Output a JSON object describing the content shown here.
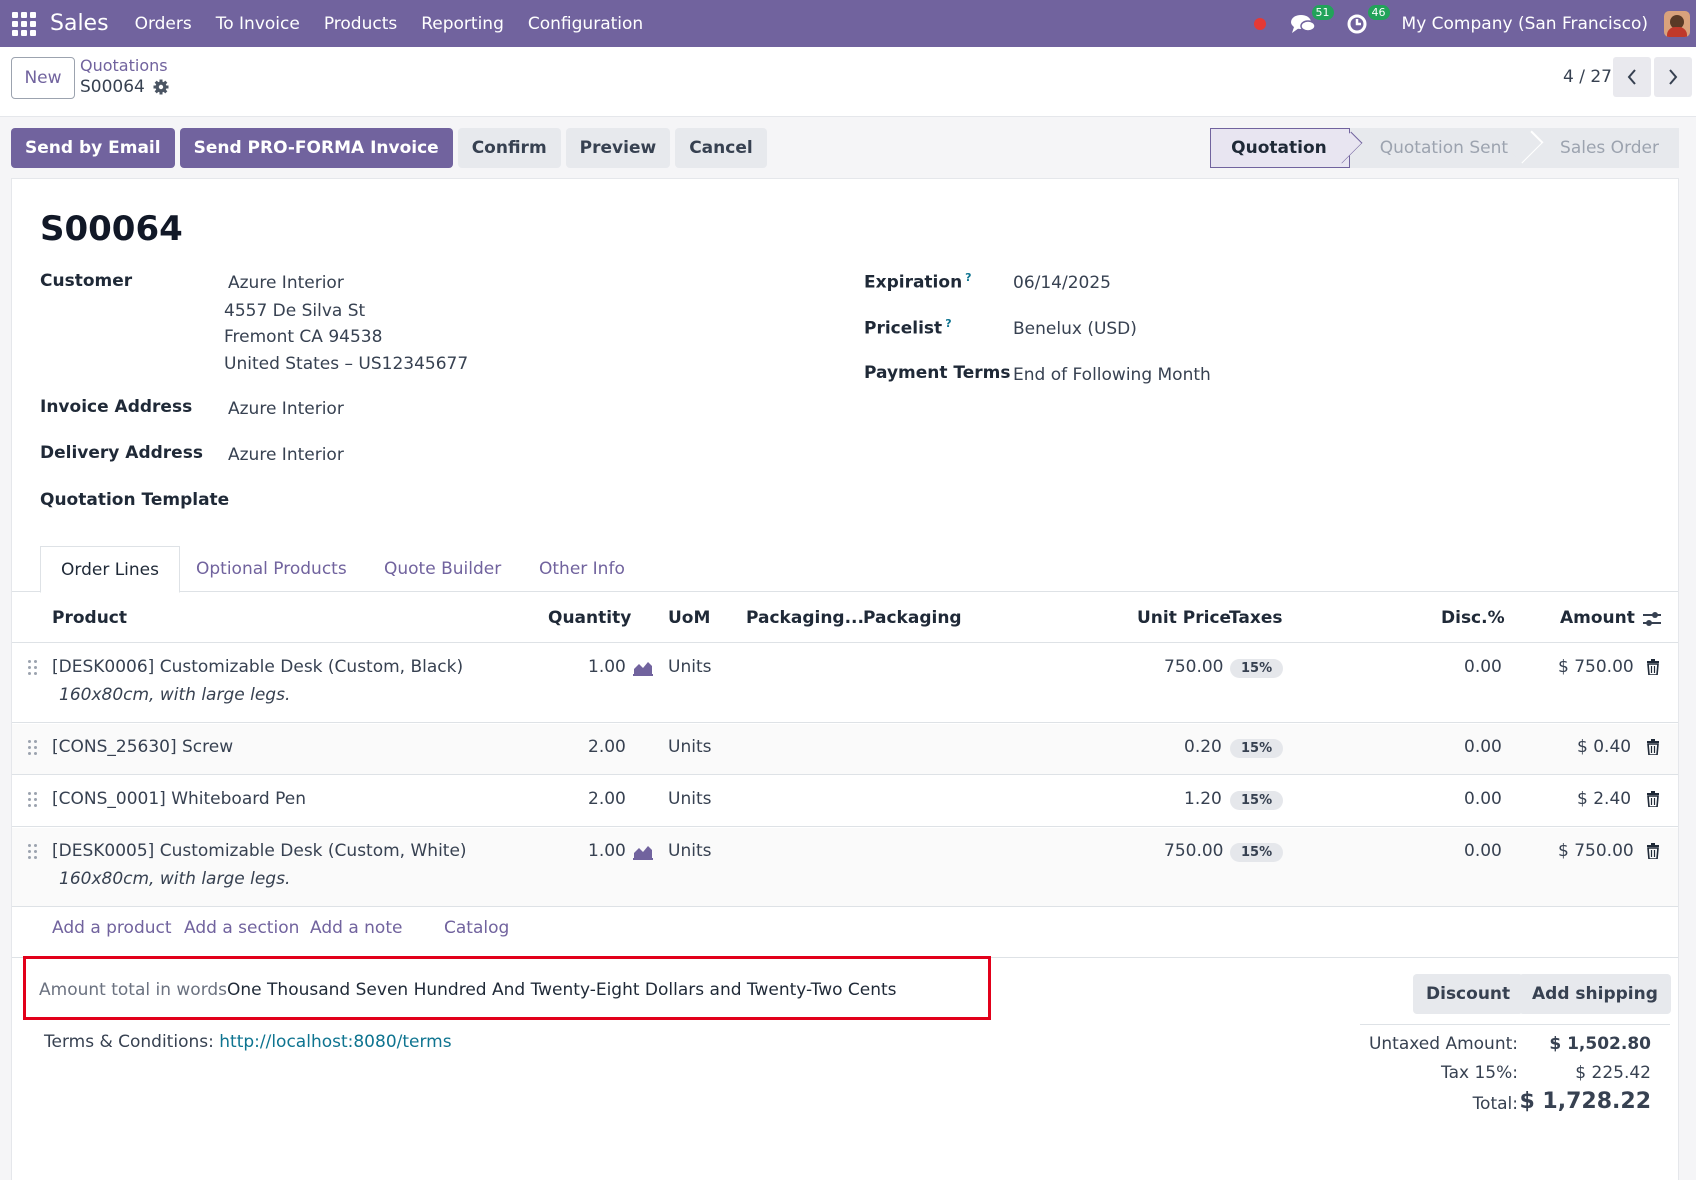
{
  "navbar": {
    "app_name": "Sales",
    "menu": [
      "Orders",
      "To Invoice",
      "Products",
      "Reporting",
      "Configuration"
    ],
    "messages_count": "51",
    "activities_count": "46",
    "company": "My Company (San Francisco)"
  },
  "control_panel": {
    "new_label": "New",
    "breadcrumb_parent": "Quotations",
    "breadcrumb_current": "S00064",
    "pager": "4 / 27"
  },
  "actions": {
    "send_email": "Send by Email",
    "send_proforma": "Send PRO-FORMA Invoice",
    "confirm": "Confirm",
    "preview": "Preview",
    "cancel": "Cancel"
  },
  "statusbar": [
    "Quotation",
    "Quotation Sent",
    "Sales Order"
  ],
  "form": {
    "title": "S00064",
    "customer_label": "Customer",
    "customer_name": "Azure Interior",
    "customer_street": "4557 De Silva St",
    "customer_city": "Fremont CA 94538",
    "customer_country": "United States – US12345677",
    "invoice_address_label": "Invoice Address",
    "invoice_address": "Azure Interior",
    "delivery_address_label": "Delivery Address",
    "delivery_address": "Azure Interior",
    "quotation_template_label": "Quotation Template",
    "expiration_label": "Expiration",
    "expiration": "06/14/2025",
    "pricelist_label": "Pricelist",
    "pricelist": "Benelux (USD)",
    "payment_terms_label": "Payment Terms",
    "payment_terms": "End of Following Month",
    "help_mark": "?"
  },
  "tabs": [
    "Order Lines",
    "Optional Products",
    "Quote Builder",
    "Other Info"
  ],
  "table": {
    "headers": {
      "product": "Product",
      "quantity": "Quantity",
      "uom": "UoM",
      "packaging_qty": "Packaging...",
      "packaging": "Packaging",
      "unit_price": "Unit Price",
      "taxes": "Taxes",
      "discount": "Disc.%",
      "amount": "Amount"
    },
    "rows": [
      {
        "product": "[DESK0006] Customizable Desk (Custom, Black)",
        "desc": "160x80cm, with large legs.",
        "qty": "1.00",
        "uom": "Units",
        "price": "750.00",
        "tax": "15%",
        "disc": "0.00",
        "amount": "$ 750.00"
      },
      {
        "product": "[CONS_25630] Screw",
        "desc": "",
        "qty": "2.00",
        "uom": "Units",
        "price": "0.20",
        "tax": "15%",
        "disc": "0.00",
        "amount": "$ 0.40"
      },
      {
        "product": "[CONS_0001] Whiteboard Pen",
        "desc": "",
        "qty": "2.00",
        "uom": "Units",
        "price": "1.20",
        "tax": "15%",
        "disc": "0.00",
        "amount": "$ 2.40"
      },
      {
        "product": "[DESK0005] Customizable Desk (Custom, White)",
        "desc": "160x80cm, with large legs.",
        "qty": "1.00",
        "uom": "Units",
        "price": "750.00",
        "tax": "15%",
        "disc": "0.00",
        "amount": "$ 750.00"
      }
    ],
    "add_product": "Add a product",
    "add_section": "Add a section",
    "add_note": "Add a note",
    "catalog": "Catalog"
  },
  "footer": {
    "amount_words_label": "Amount total in words",
    "amount_words_value": "One Thousand Seven Hundred And Twenty-Eight Dollars and Twenty-Two Cents",
    "terms_label": "Terms & Conditions: ",
    "terms_link": "http://localhost:8080/terms",
    "discount_btn": "Discount",
    "shipping_btn": "Add shipping",
    "untaxed_label": "Untaxed Amount:",
    "untaxed_value": "$ 1,502.80",
    "tax_label": "Tax 15%:",
    "tax_value": "$ 225.42",
    "total_label": "Total:",
    "total_value": "$ 1,728.22"
  }
}
